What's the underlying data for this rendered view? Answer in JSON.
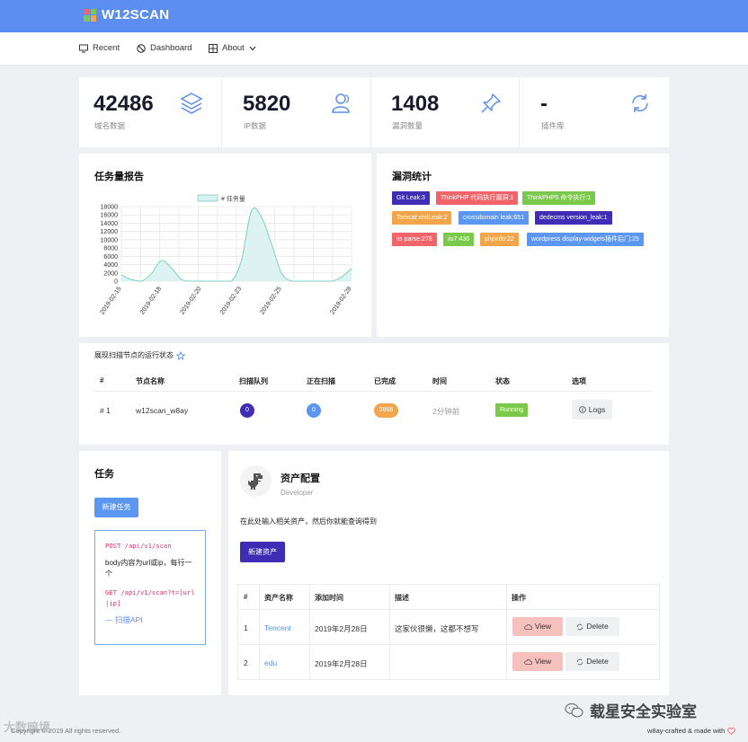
{
  "app": {
    "title": "W12SCAN"
  },
  "nav": {
    "recent": "Recent",
    "dashboard": "Dashboard",
    "about": "About"
  },
  "stats": [
    {
      "value": "42486",
      "label": "域名数据",
      "icon": "layers-icon"
    },
    {
      "value": "5820",
      "label": "IP数据",
      "icon": "users-icon"
    },
    {
      "value": "1408",
      "label": "漏洞数量",
      "icon": "pin-icon"
    },
    {
      "value": "-",
      "label": "插件库",
      "icon": "refresh-icon"
    }
  ],
  "task_report": {
    "title": "任务量报告",
    "legend": "# 任务量"
  },
  "chart_data": {
    "type": "area",
    "title": "任务量报告",
    "series": [
      {
        "name": "# 任务量",
        "values": [
          1500,
          400,
          0,
          1800,
          5000,
          3200,
          400,
          0,
          0,
          0,
          0,
          0,
          5000,
          17000,
          15500,
          9000,
          2000,
          0,
          0,
          0,
          0,
          0,
          1000,
          3000
        ]
      }
    ],
    "x_ticks": [
      "2019-02-15",
      "2019-02-18",
      "2019-02-20",
      "2019-02-23",
      "2019-02-25",
      "2019-02-28"
    ],
    "y_ticks": [
      "0",
      "2000",
      "4000",
      "6000",
      "8000",
      "10000",
      "12000",
      "14000",
      "16000",
      "18000"
    ],
    "ylim": [
      0,
      18000
    ],
    "grid": true,
    "legend_position": "top-center",
    "color": "#d8f2ef",
    "line_color": "#7fcfc4"
  },
  "vuln_stats": {
    "title": "漏洞统计",
    "tags": [
      {
        "text": "Git Leak:3",
        "color": "#3f2db5"
      },
      {
        "text": "ThinkPHP 代码执行漏洞:1",
        "color": "#f0646a"
      },
      {
        "text": "ThinkPHP5 命令执行:1",
        "color": "#7bc94a"
      },
      {
        "text": "Tomcat xmlLeak:2",
        "color": "#f2a54a"
      },
      {
        "text": "crossdomain leak:651",
        "color": "#5b96f0"
      },
      {
        "text": "dedecms version_leak:1",
        "color": "#3f2db5"
      },
      {
        "text": "iis parse:278",
        "color": "#f0646a"
      },
      {
        "text": "iis7:436",
        "color": "#7bc94a"
      },
      {
        "text": "phpinfo:22",
        "color": "#f2a54a"
      },
      {
        "text": "wordpress display-widgets插件后门:25",
        "color": "#5b96f0"
      }
    ]
  },
  "nodes": {
    "title": "展现扫描节点的运行状态",
    "headers": [
      "#",
      "节点名称",
      "扫描队列",
      "正在扫描",
      "已完成",
      "时间",
      "状态",
      "选项"
    ],
    "row": {
      "index": "# 1",
      "name": "w12scan_w8ay",
      "queue": "0",
      "scanning": "0",
      "done": "2866",
      "time": "2分钟前",
      "status": "Running",
      "action": "Logs"
    }
  },
  "tasks": {
    "title": "任务",
    "new_button": "新建任务",
    "api_post": "POST /api/v1/scan",
    "api_desc": "body内容为url或ip，每行一个",
    "api_get": "GET /api/v1/scan?t=[url|ip]",
    "api_link": "— 扫描API"
  },
  "assets": {
    "title": "资产配置",
    "subtitle": "Developer",
    "desc": "在此处输入相关资产，然后你就能查询得到",
    "new_button": "新建资产",
    "headers": [
      "#",
      "资产名称",
      "添加时间",
      "描述",
      "操作"
    ],
    "rows": [
      {
        "id": "1",
        "name": "Tencent",
        "date": "2019年2月28日",
        "desc": "这家伙很懒，这都不想写",
        "view": "View",
        "delete": "Delete"
      },
      {
        "id": "2",
        "name": "edu",
        "date": "2019年2月28日",
        "desc": "",
        "view": "View",
        "delete": "Delete"
      }
    ]
  },
  "footer": {
    "copyright": "Copyright © 2019 All rights reserved.",
    "credit": "w8ay-crafted & made with",
    "watermark": "载星安全实验室",
    "watermark_left": "大数暗境"
  },
  "colors": {
    "primary": "#5b8ef0",
    "indigo": "#3f2db5",
    "orange": "#f2a54a",
    "green": "#7bc94a",
    "view_bg": "#f6c1bd"
  }
}
